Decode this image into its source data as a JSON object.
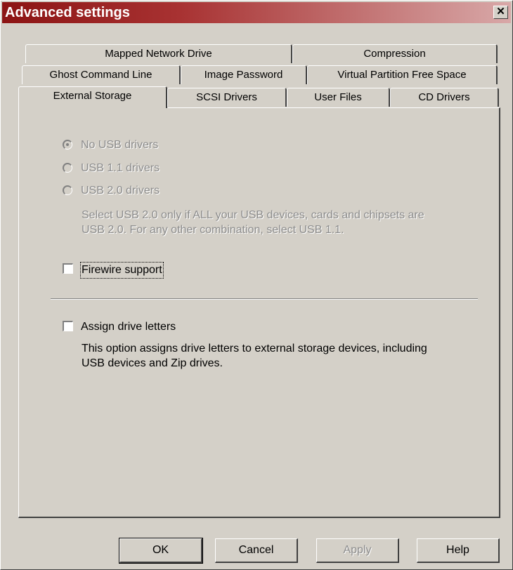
{
  "window": {
    "title": "Advanced settings",
    "close_glyph": "✕"
  },
  "tabs": {
    "row1": [
      "Mapped Network Drive",
      "Compression"
    ],
    "row2": [
      "Ghost Command Line",
      "Image Password",
      "Virtual Partition Free Space"
    ],
    "row3": [
      "External Storage",
      "SCSI Drivers",
      "User Files",
      "CD Drivers"
    ],
    "active": "External Storage"
  },
  "usb": {
    "options": [
      "No USB drivers",
      "USB 1.1 drivers",
      "USB 2.0 drivers"
    ],
    "selected": "No USB drivers",
    "enabled": false,
    "note_line1": "Select USB 2.0 only if ALL your USB devices, cards and chipsets are",
    "note_line2": "USB 2.0. For any other combination, select USB 1.1."
  },
  "firewire": {
    "label": "Firewire support",
    "checked": false
  },
  "drive_letters": {
    "label": "Assign drive letters",
    "checked": false,
    "desc_line1": "This option assigns drive letters to external storage devices, including",
    "desc_line2": "USB devices and Zip drives."
  },
  "buttons": {
    "ok": "OK",
    "cancel": "Cancel",
    "apply": "Apply",
    "help": "Help",
    "apply_enabled": false
  }
}
